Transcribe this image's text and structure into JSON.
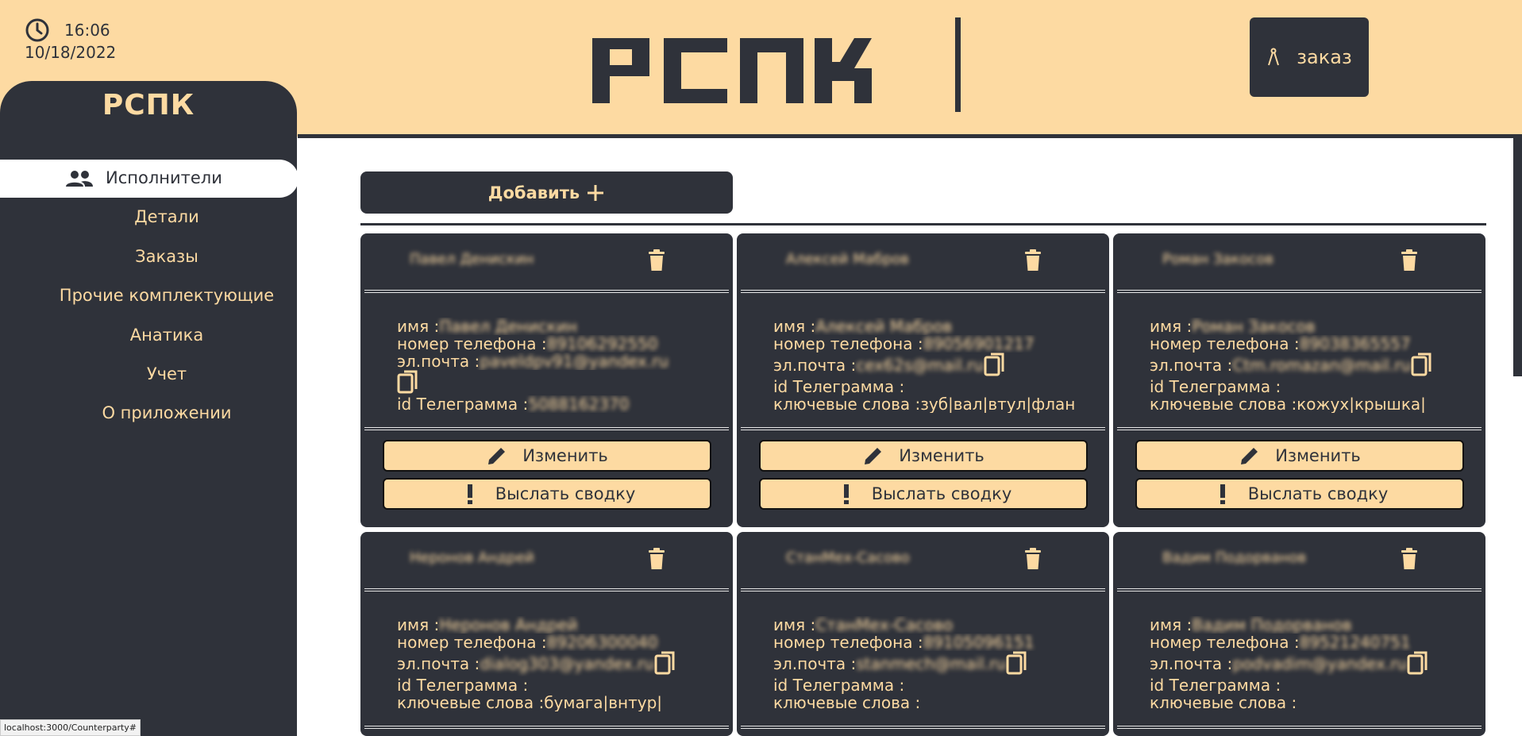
{
  "header": {
    "time": "16:06",
    "date": "10/18/2022",
    "logo_text": "РСПК",
    "order_button": "заказ"
  },
  "sidebar": {
    "brand": "РСПК",
    "items": [
      {
        "label": "Исполнители",
        "active": true,
        "icon": "people-icon"
      },
      {
        "label": "Детали"
      },
      {
        "label": "Заказы"
      },
      {
        "label": "Прочие комплектующие"
      },
      {
        "label": "Анатика"
      },
      {
        "label": "Учет"
      },
      {
        "label": "О приложении"
      }
    ]
  },
  "main": {
    "add_button": "Добавить"
  },
  "labels": {
    "name": "имя : ",
    "phone": "номер телефона : ",
    "email": "эл.почта : ",
    "telegram": "id Телеграмма : ",
    "keywords": "ключевые слова : ",
    "edit": "Изменить",
    "send": "Выслать сводку"
  },
  "cards": [
    {
      "title": "Павел Денискин",
      "name": "Павел Денискин",
      "phone": "89106292550",
      "email": "paveldpv91@yandex.ru",
      "telegram": "5088162370",
      "keywords": ""
    },
    {
      "title": "Алексей Мабров",
      "name": "Алексей Мабров",
      "phone": "89056901217",
      "email": "cex62s@mail.ru",
      "telegram": "",
      "keywords": "зуб|вал|втул|флан"
    },
    {
      "title": "Роман Закосов",
      "name": "Роман Закосов",
      "phone": "89038365557",
      "email": "Ctm.romazan@mail.ru",
      "telegram": "",
      "keywords": "кожух|крышка|"
    },
    {
      "title": "Неронов Андрей",
      "name": "Неронов Андрей",
      "phone": "89206300040",
      "email": "dialog303@yandex.ru",
      "telegram": "",
      "keywords": "бумага|внтур|"
    },
    {
      "title": "СтанМех-Сасово",
      "name": "СтанМех-Сасово",
      "phone": "89105096151",
      "email": "stanmech@mail.ru",
      "telegram": "",
      "keywords": ""
    },
    {
      "title": "Вадим Подорванов",
      "name": "Вадим Подорванов",
      "phone": "89521240751",
      "email": "podvadim@yandex.ru",
      "telegram": "",
      "keywords": ""
    }
  ],
  "status_url": "localhost:3000/Counterparty#",
  "colors": {
    "dark": "#2F323A",
    "accent": "#FDDAA2"
  }
}
